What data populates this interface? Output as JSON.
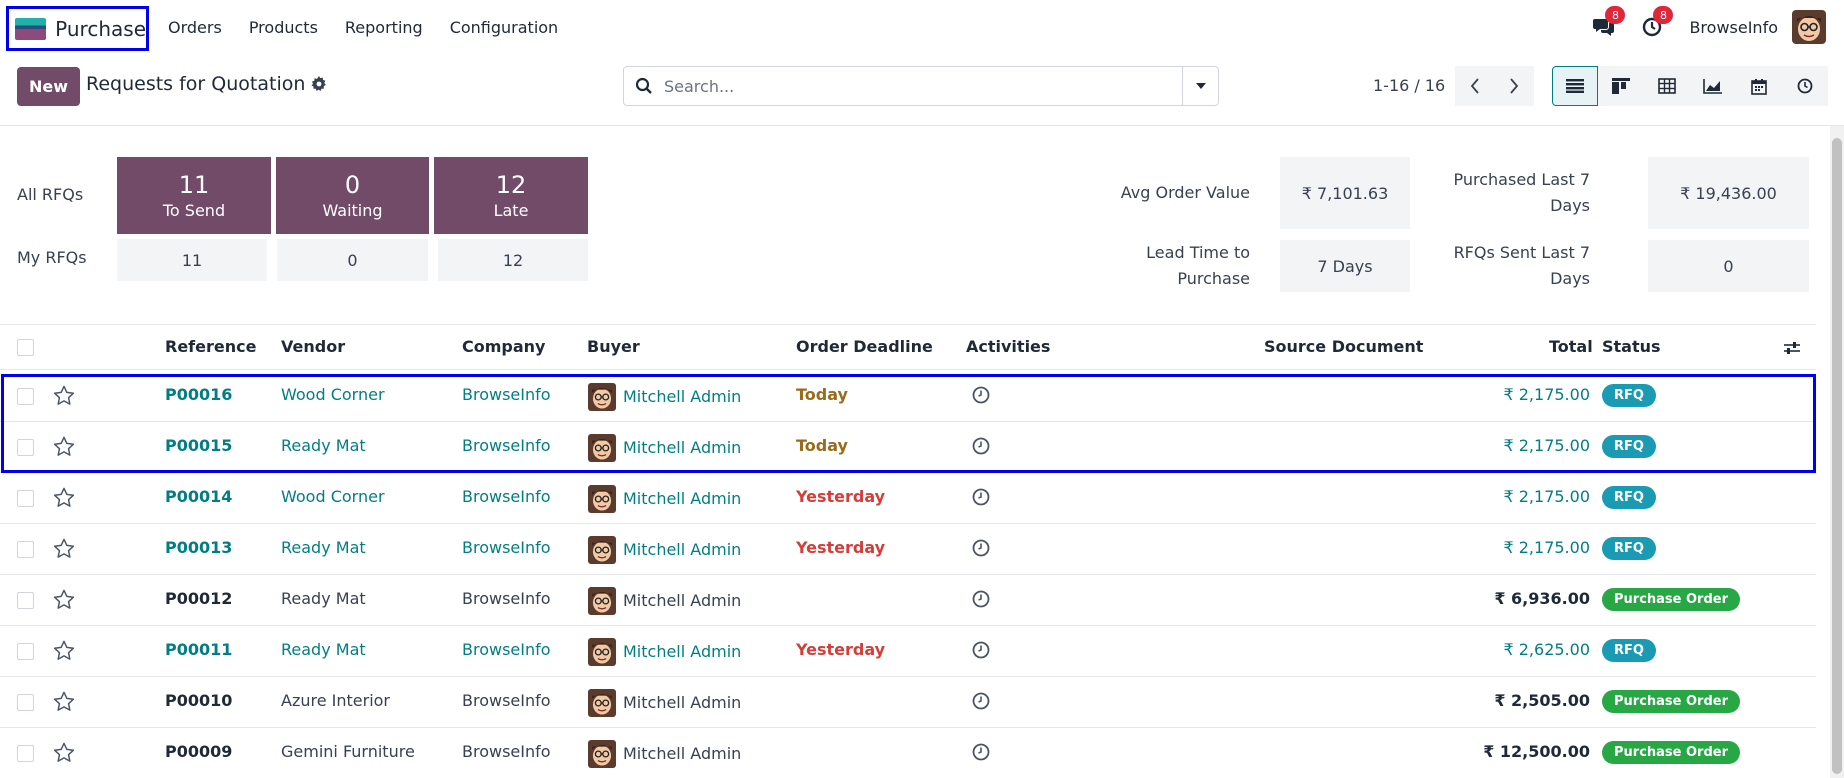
{
  "navbar": {
    "app_name": "Purchase",
    "menu": [
      "Orders",
      "Products",
      "Reporting",
      "Configuration"
    ],
    "messages_count": "8",
    "activities_count": "8",
    "company": "BrowseInfo"
  },
  "control": {
    "new_label": "New",
    "title": "Requests for Quotation",
    "search_placeholder": "Search...",
    "pager": "1-16 / 16"
  },
  "dashboard": {
    "all_rfqs_label": "All RFQs",
    "my_rfqs_label": "My RFQs",
    "tiles": [
      {
        "num": "11",
        "label": "To Send",
        "mine": "11"
      },
      {
        "num": "0",
        "label": "Waiting",
        "mine": "0"
      },
      {
        "num": "12",
        "label": "Late",
        "mine": "12"
      }
    ],
    "kpis": {
      "avg_order_label_1": "Avg Order Value",
      "avg_order_value": "₹ 7,101.63",
      "purchased_label_1": "Purchased Last 7",
      "purchased_label_2": "Days",
      "purchased_value": "₹ 19,436.00",
      "lead_label_1": "Lead Time to",
      "lead_label_2": "Purchase",
      "lead_value": "7 Days",
      "rfqs_sent_label_1": "RFQs Sent Last 7",
      "rfqs_sent_label_2": "Days",
      "rfqs_sent_value": "0"
    }
  },
  "table": {
    "headers": {
      "reference": "Reference",
      "vendor": "Vendor",
      "company": "Company",
      "buyer": "Buyer",
      "deadline": "Order Deadline",
      "activities": "Activities",
      "source": "Source Document",
      "total": "Total",
      "status": "Status"
    },
    "rows": [
      {
        "ref": "P00016",
        "vendor": "Wood Corner",
        "company": "BrowseInfo",
        "buyer": "Mitchell Admin",
        "deadline": "Today",
        "total": "₹ 2,175.00",
        "status": "RFQ"
      },
      {
        "ref": "P00015",
        "vendor": "Ready Mat",
        "company": "BrowseInfo",
        "buyer": "Mitchell Admin",
        "deadline": "Today",
        "total": "₹ 2,175.00",
        "status": "RFQ"
      },
      {
        "ref": "P00014",
        "vendor": "Wood Corner",
        "company": "BrowseInfo",
        "buyer": "Mitchell Admin",
        "deadline": "Yesterday",
        "total": "₹ 2,175.00",
        "status": "RFQ"
      },
      {
        "ref": "P00013",
        "vendor": "Ready Mat",
        "company": "BrowseInfo",
        "buyer": "Mitchell Admin",
        "deadline": "Yesterday",
        "total": "₹ 2,175.00",
        "status": "RFQ"
      },
      {
        "ref": "P00012",
        "vendor": "Ready Mat",
        "company": "BrowseInfo",
        "buyer": "Mitchell Admin",
        "deadline": "",
        "total": "₹ 6,936.00",
        "status": "Purchase Order"
      },
      {
        "ref": "P00011",
        "vendor": "Ready Mat",
        "company": "BrowseInfo",
        "buyer": "Mitchell Admin",
        "deadline": "Yesterday",
        "total": "₹ 2,625.00",
        "status": "RFQ"
      },
      {
        "ref": "P00010",
        "vendor": "Azure Interior",
        "company": "BrowseInfo",
        "buyer": "Mitchell Admin",
        "deadline": "",
        "total": "₹ 2,505.00",
        "status": "Purchase Order"
      },
      {
        "ref": "P00009",
        "vendor": "Gemini Furniture",
        "company": "BrowseInfo",
        "buyer": "Mitchell Admin",
        "deadline": "",
        "total": "₹ 12,500.00",
        "status": "Purchase Order"
      }
    ]
  },
  "colors": {
    "brand": "#714b67",
    "accent": "#017e84",
    "rfq_badge": "#1a9bb3",
    "po_badge": "#28a745",
    "today": "#9a6b1b",
    "yesterday": "#d23f3a",
    "highlight": "#0000ee"
  }
}
